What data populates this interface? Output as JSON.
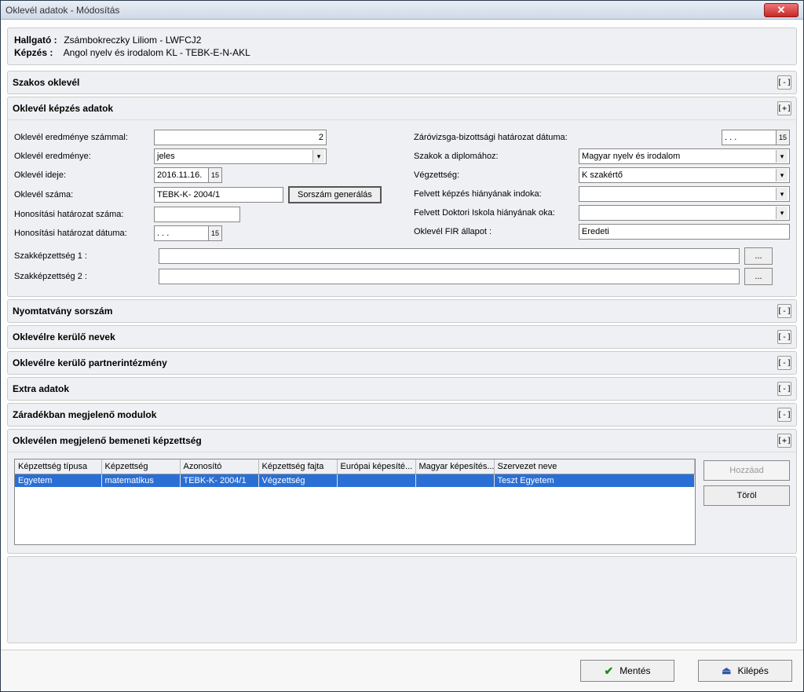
{
  "window": {
    "title": "Oklevél adatok - Módosítás"
  },
  "student": {
    "label": "Hallgató :",
    "value": "Zsámbokreczky Liliom - LWFCJ2"
  },
  "training": {
    "label": "Képzés :",
    "value": "Angol nyelv és irodalom KL - TEBK-E-N-AKL"
  },
  "sections": {
    "s1": "Szakos oklevél",
    "s2": "Oklevél képzés adatok",
    "s3": "Nyomtatvány sorszám",
    "s4": "Oklevélre kerülő nevek",
    "s5": "Oklevélre kerülő partnerintézmény",
    "s6": "Extra adatok",
    "s7": "Záradékban megjelenő modulok",
    "s8": "Oklevélen megjelenő bemeneti képzettség"
  },
  "toggle": {
    "plus": "[+]",
    "minus": "[-]"
  },
  "form": {
    "l_result_num": "Oklevél eredménye számmal:",
    "v_result_num": "2",
    "l_result": "Oklevél eredménye:",
    "v_result": "jeles",
    "l_date": "Oklevél ideje:",
    "v_date": "2016.11.16.",
    "l_number": "Oklevél száma:",
    "v_number": "TEBK-K- 2004/1",
    "btn_gen": "Sorszám generálás",
    "l_honcert": "Honosítási határozat száma:",
    "v_honcert": "",
    "l_hondate": "Honosítási határozat dátuma:",
    "v_hondate": ". . .",
    "l_qual1": "Szakképzettség 1 :",
    "v_qual1": "",
    "l_qual2": "Szakképzettség 2 :",
    "v_qual2": "",
    "ellipsis": "...",
    "r_finaldate": "Záróvizsga-bizottsági határozat dátuma:",
    "v_finaldate": ". . .",
    "r_majors": "Szakok a diplomához:",
    "v_majors": "Magyar nyelv és irodalom",
    "r_degree": "Végzettség:",
    "v_degree": "K szakértő",
    "r_reason": "Felvett képzés hiányának indoka:",
    "v_reason": "",
    "r_doktori": "Felvett Doktori Iskola hiányának oka:",
    "v_doktori": "",
    "r_fir": "Oklevél FIR állapot :",
    "v_fir": "Eredeti",
    "cal_icon": "15"
  },
  "table": {
    "headers": [
      "Képzettség típusa",
      "Képzettség",
      "Azonosító",
      "Képzettség fajta",
      "Európai képesíté...",
      "Magyar képesítés...",
      "Szervezet neve"
    ],
    "rows": [
      {
        "c0": "Egyetem",
        "c1": "matematikus",
        "c2": "TEBK-K- 2004/1",
        "c3": "Végzettség",
        "c4": "",
        "c5": "",
        "c6": "Teszt Egyetem"
      }
    ],
    "btn_add": "Hozzáad",
    "btn_del": "Töröl"
  },
  "footer": {
    "save": "Mentés",
    "exit": "Kilépés"
  }
}
